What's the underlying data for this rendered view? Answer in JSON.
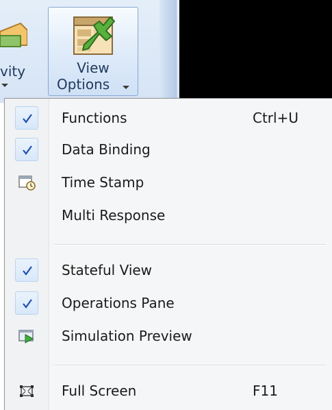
{
  "ribbon": {
    "activity_label": "vity",
    "view_options_line1": "View",
    "view_options_line2": "Options"
  },
  "menu": {
    "items": [
      {
        "label": "Functions",
        "shortcut": "Ctrl+U",
        "checked": true,
        "icon": "check-icon"
      },
      {
        "label": "Data Binding",
        "shortcut": "",
        "checked": true,
        "icon": "check-icon"
      },
      {
        "label": "Time Stamp",
        "shortcut": "",
        "checked": false,
        "icon": "time-stamp-icon"
      },
      {
        "label": "Multi Response",
        "shortcut": "",
        "checked": false,
        "icon": ""
      },
      {
        "label": "Stateful View",
        "shortcut": "",
        "checked": true,
        "icon": "check-icon"
      },
      {
        "label": "Operations Pane",
        "shortcut": "",
        "checked": true,
        "icon": "check-icon"
      },
      {
        "label": "Simulation Preview",
        "shortcut": "",
        "checked": false,
        "icon": "simulation-preview-icon"
      },
      {
        "label": "Full Screen",
        "shortcut": "F11",
        "checked": false,
        "icon": "full-screen-icon"
      }
    ]
  },
  "colors": {
    "check": "#1f4fb4",
    "ribbon_bg": "#dce8f6",
    "menu_bg": "#f5f6f7"
  }
}
